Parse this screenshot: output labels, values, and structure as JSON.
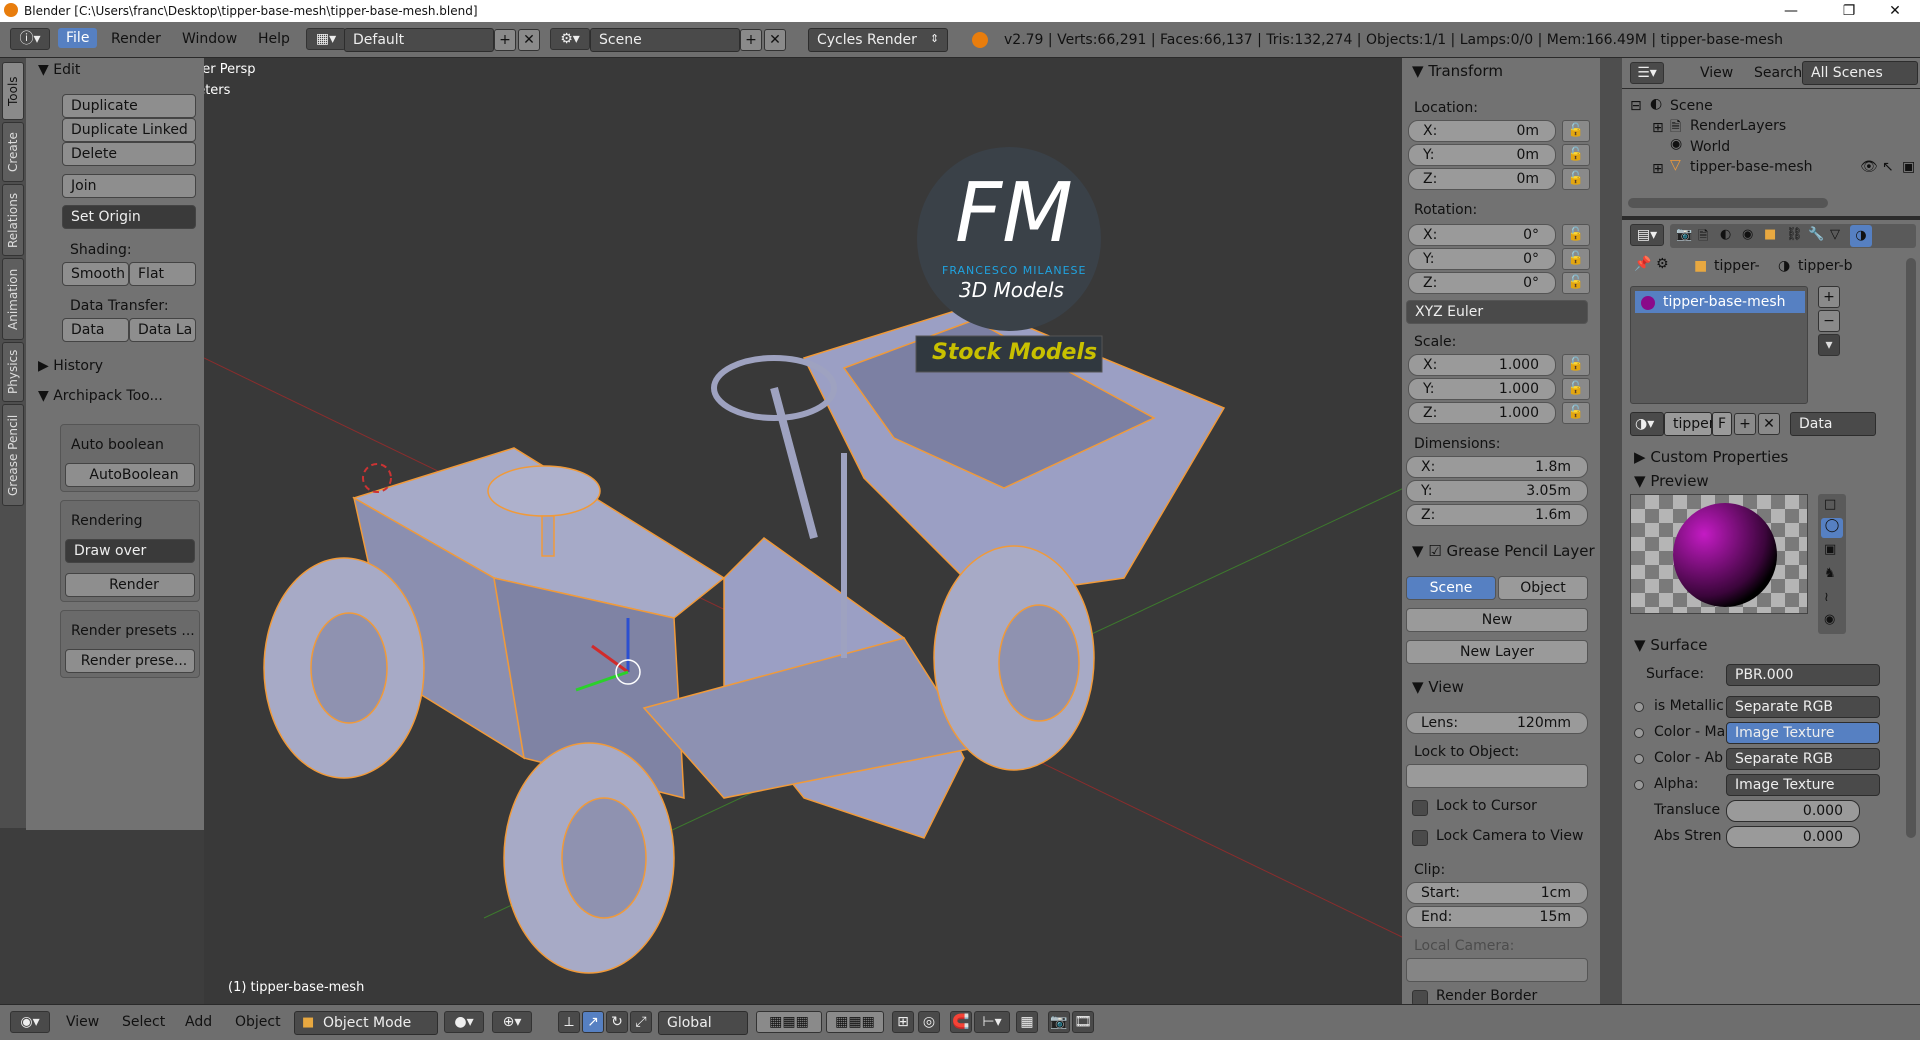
{
  "window": {
    "title": "Blender [C:\\Users\\franc\\Desktop\\tipper-base-mesh\\tipper-base-mesh.blend]"
  },
  "topbar": {
    "menus": [
      "File",
      "Render",
      "Window",
      "Help"
    ],
    "layout": "Default",
    "scene": "Scene",
    "engine": "Cycles Render",
    "stats": "v2.79 | Verts:66,291 | Faces:66,137 | Tris:132,274 | Objects:1/1 | Lamps:0/0 | Mem:166.49M | tipper-base-mesh"
  },
  "tabs": [
    "Tools",
    "Create",
    "Relations",
    "Animation",
    "Physics",
    "Grease Pencil"
  ],
  "toolshelf": {
    "edit_header": "Edit",
    "duplicate": "Duplicate",
    "duplicate_linked": "Duplicate Linked",
    "delete": "Delete",
    "join": "Join",
    "set_origin": "Set Origin",
    "shading_label": "Shading:",
    "smooth": "Smooth",
    "flat": "Flat",
    "data_transfer_label": "Data Transfer:",
    "data": "Data",
    "data_la": "Data La",
    "history": "History",
    "archipack": "Archipack Too...",
    "auto_boolean_label": "Auto boolean",
    "auto_boolean_btn": "AutoBoolean",
    "rendering_label": "Rendering",
    "draw_over": "Draw over",
    "render": "Render",
    "render_presets_label": "Render presets ...",
    "render_presets_btn": "Render prese..."
  },
  "viewport": {
    "view_name": "User Persp",
    "units": "Meters",
    "object_label": "(1) tipper-base-mesh",
    "logo_fm": "FM",
    "logo_author": "FRANCESCO MILANESE",
    "logo_sub": "3D Models",
    "stock": "Stock Models"
  },
  "bottombar": {
    "view": "View",
    "select": "Select",
    "add": "Add",
    "object": "Object",
    "mode": "Object Mode",
    "orientation": "Global"
  },
  "npanel": {
    "transform": "Transform",
    "location": "Location:",
    "loc": [
      {
        "k": "X:",
        "v": "0m"
      },
      {
        "k": "Y:",
        "v": "0m"
      },
      {
        "k": "Z:",
        "v": "0m"
      }
    ],
    "rotation": "Rotation:",
    "rot": [
      {
        "k": "X:",
        "v": "0°"
      },
      {
        "k": "Y:",
        "v": "0°"
      },
      {
        "k": "Z:",
        "v": "0°"
      }
    ],
    "rot_mode": "XYZ Euler",
    "scale": "Scale:",
    "scl": [
      {
        "k": "X:",
        "v": "1.000"
      },
      {
        "k": "Y:",
        "v": "1.000"
      },
      {
        "k": "Z:",
        "v": "1.000"
      }
    ],
    "dimensions": "Dimensions:",
    "dim": [
      {
        "k": "X:",
        "v": "1.8m"
      },
      {
        "k": "Y:",
        "v": "3.05m"
      },
      {
        "k": "Z:",
        "v": "1.6m"
      }
    ],
    "grease": "Grease Pencil Layer",
    "scene_btn": "Scene",
    "object_btn": "Object",
    "new": "New",
    "new_layer": "New Layer",
    "view": "View",
    "lens": "Lens:",
    "lens_v": "120mm",
    "lock_obj": "Lock to Object:",
    "lock_cursor": "Lock to Cursor",
    "lock_cam": "Lock Camera to View",
    "clip": "Clip:",
    "start": "Start:",
    "start_v": "1cm",
    "end": "End:",
    "end_v": "15m",
    "local_cam": "Local Camera:",
    "render_border": "Render Border"
  },
  "outliner": {
    "view": "View",
    "search": "Search",
    "filter": "All Scenes",
    "scene": "Scene",
    "renderlayers": "RenderLayers",
    "world": "World",
    "mesh": "tipper-base-mesh"
  },
  "props": {
    "crumb1": "tipper-",
    "crumb2": "tipper-b",
    "slot": "tipper-base-mesh",
    "mat_name": "tipper",
    "f": "F",
    "data": "Data",
    "custom": "Custom Properties",
    "preview": "Preview",
    "surface_header": "Surface",
    "surface_label": "Surface:",
    "surface_val": "PBR.000",
    "rows": [
      {
        "l": "is Metallic",
        "v": "Separate RGB"
      },
      {
        "l": "Color - Ma",
        "v": "Image Texture"
      },
      {
        "l": "Color - Ab",
        "v": "Separate RGB"
      },
      {
        "l": "Alpha:",
        "v": "Image Texture"
      }
    ],
    "transluce": "Transluce",
    "transluce_v": "0.000",
    "abs": "Abs Stren",
    "abs_v": "0.000"
  },
  "colors": {
    "accent": "#5680c2",
    "orange_select": "#f09a3a",
    "viewport_bg": "#393939"
  }
}
